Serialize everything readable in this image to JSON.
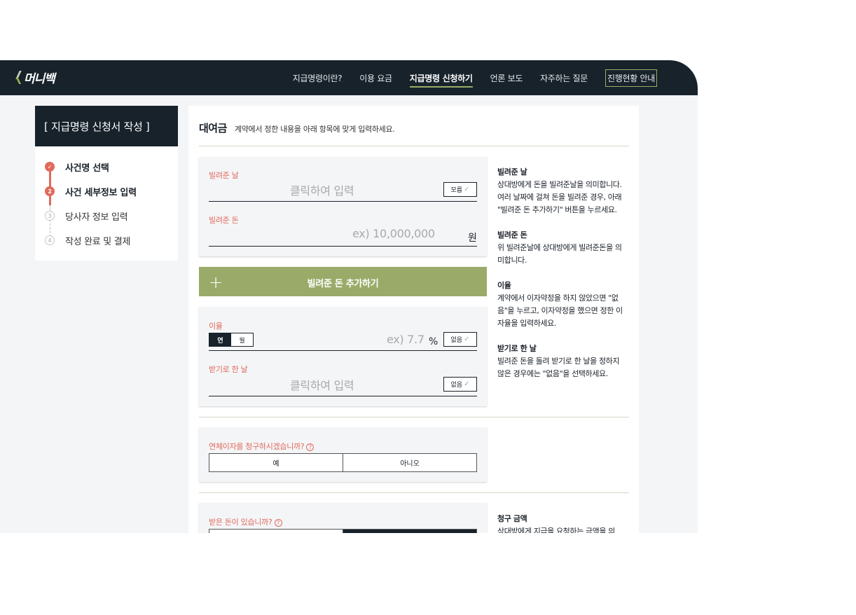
{
  "brand": {
    "logo_text": "머니백"
  },
  "nav": {
    "items": [
      "지급명령이란?",
      "이용 요금",
      "지급명령 신청하기",
      "언론 보도",
      "자주하는 질문"
    ],
    "active_index": 2,
    "progress_label": "진행현황 안내"
  },
  "sidebar": {
    "title": "[ 지급명령 신청서 작성 ]",
    "steps": [
      {
        "num": "✓",
        "label": "사건명 선택"
      },
      {
        "num": "2",
        "label": "사건 세부정보 입력"
      },
      {
        "num": "3",
        "label": "당사자 정보 입력"
      },
      {
        "num": "4",
        "label": "작성 완료 및 결제"
      }
    ]
  },
  "main": {
    "title": "대여금",
    "description": "계약에서 정한 내용을 아래 항목에 맞게 입력하세요.",
    "loan_date": {
      "label": "빌려준 날",
      "placeholder": "클릭하여 입력",
      "unknown_btn": "모름"
    },
    "loan_amount": {
      "label": "빌려준 돈",
      "placeholder": "ex) 10,000,000",
      "unit": "원"
    },
    "add_button": {
      "label": "빌려준 돈 추가하기"
    },
    "interest": {
      "label": "이율",
      "seg_year": "연",
      "seg_month": "월",
      "placeholder": "ex) 7.7",
      "unit": "%",
      "none_btn": "없음"
    },
    "due_date": {
      "label": "받기로 한 날",
      "placeholder": "클릭하여 입력",
      "none_btn": "없음"
    },
    "late_interest": {
      "question": "연체이자를 청구하시겠습니까?",
      "yes": "예",
      "no": "아니오"
    },
    "received": {
      "question": "받은 돈이 있습니까?"
    }
  },
  "help": [
    {
      "title": "빌려준 날",
      "body": "상대방에게 돈을 빌려준날을 의미합니다. 여러 날짜에 걸쳐 돈을 빌려준 경우, 아래 \"빌려준 돈 추가하기\" 버튼을 누르세요."
    },
    {
      "title": "빌려준 돈",
      "body": "위 빌려준날에 상대방에게 빌려준돈을 의미합니다."
    },
    {
      "title": "이율",
      "body": "계약에서 이자약정을 하지 않았으면 \"없음\"을 누르고, 이자약정을 했으면 정한 이자율을 입력하세요."
    },
    {
      "title": "받기로 한 날",
      "body": "빌려준 돈을 돌려 받기로 한 날을 정하지 않은 경우에는 \"없음\"을 선택하세요."
    }
  ],
  "help2": {
    "title": "청구 금액",
    "body": "상대방에게 지급을 요청하는 금액을 의"
  },
  "colors": {
    "navy": "#17222b",
    "accent": "#9aab69",
    "label_red": "#e06a5c"
  }
}
